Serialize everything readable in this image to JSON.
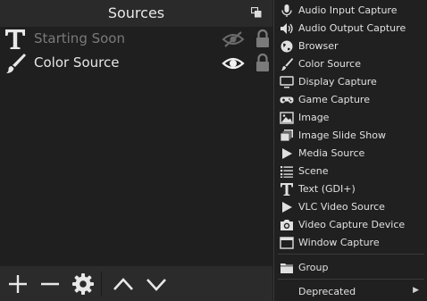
{
  "sources_dock": {
    "title": "Sources",
    "items": [
      {
        "name": "Starting Soon",
        "type_icon": "text-icon",
        "visible": false,
        "locked": true
      },
      {
        "name": "Color Source",
        "type_icon": "brush-icon",
        "visible": true,
        "locked": true
      }
    ],
    "toolbar": [
      "add-icon",
      "remove-icon",
      "gear-icon",
      "chevron-up-icon",
      "chevron-down-icon"
    ]
  },
  "add_source_menu": {
    "items": [
      {
        "label": "Audio Input Capture",
        "icon": "microphone-icon"
      },
      {
        "label": "Audio Output Capture",
        "icon": "speaker-icon"
      },
      {
        "label": "Browser",
        "icon": "globe-icon"
      },
      {
        "label": "Color Source",
        "icon": "brush-icon"
      },
      {
        "label": "Display Capture",
        "icon": "monitor-icon"
      },
      {
        "label": "Game Capture",
        "icon": "gamepad-icon"
      },
      {
        "label": "Image",
        "icon": "image-icon"
      },
      {
        "label": "Image Slide Show",
        "icon": "slideshow-icon"
      },
      {
        "label": "Media Source",
        "icon": "play-icon"
      },
      {
        "label": "Scene",
        "icon": "list-icon"
      },
      {
        "label": "Text (GDI+)",
        "icon": "text-icon"
      },
      {
        "label": "VLC Video Source",
        "icon": "play-icon"
      },
      {
        "label": "Video Capture Device",
        "icon": "camera-icon"
      },
      {
        "label": "Window Capture",
        "icon": "window-icon"
      }
    ],
    "group_label": "Group",
    "deprecated_label": "Deprecated"
  }
}
